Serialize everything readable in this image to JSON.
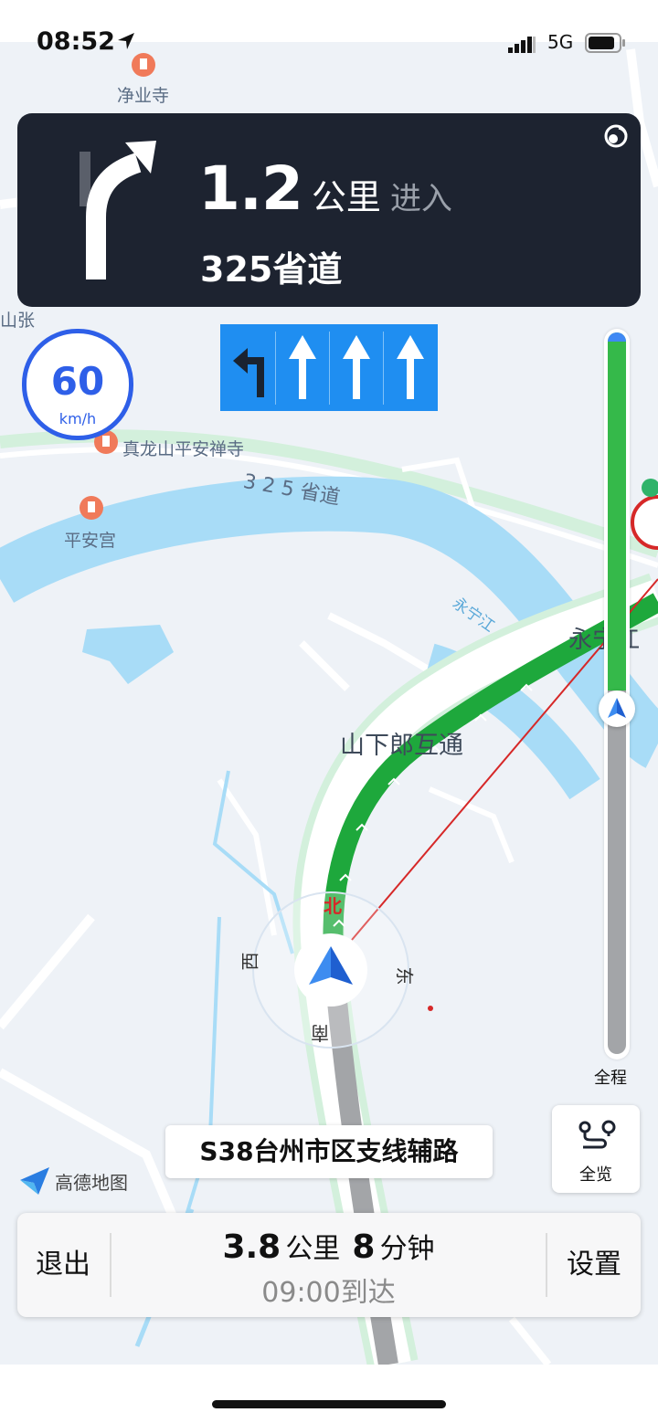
{
  "status_bar": {
    "time": "08:52",
    "network": "5G",
    "icons": [
      "location-arrow-icon",
      "signal-icon",
      "battery-icon"
    ]
  },
  "guidance": {
    "distance_value": "1.2",
    "distance_unit": "公里",
    "action": "进入",
    "road": "325省道",
    "turn_icon": "turn-right-arrow-icon"
  },
  "lanes": [
    "turn-left",
    "straight",
    "straight",
    "straight"
  ],
  "speed_limit": {
    "value": "60",
    "unit": "km/h"
  },
  "map_labels": {
    "temple1": "净业寺",
    "temple2": "真龙山平安禅寺",
    "temple3": "平安宫",
    "village": "山张",
    "road_325": "3 2 5 省道",
    "river": "永宁江",
    "interchange": "山下郎互通",
    "river_name_partial": "永宁江",
    "compass_north": "北",
    "compass_south": "南",
    "compass_east": "东",
    "compass_west": "西"
  },
  "route_progress": {
    "completed_fraction": 0.5,
    "label": "全程"
  },
  "overview_button": {
    "label": "全览"
  },
  "current_road": "S38台州市区支线辅路",
  "logo_text": "高德地图",
  "trip": {
    "remaining_distance": "3.8",
    "distance_unit": "公里",
    "remaining_time": "8",
    "time_unit": "分钟",
    "arrival_time": "09:00",
    "arrival_suffix": "到达"
  },
  "buttons": {
    "exit": "退出",
    "settings": "设置"
  },
  "colors": {
    "route_green": "#1ea83c",
    "route_grey": "#a3a5a8",
    "river_blue": "#a8dcf7",
    "accent_blue": "#2e5fe8",
    "card_dark": "#1d2330"
  }
}
